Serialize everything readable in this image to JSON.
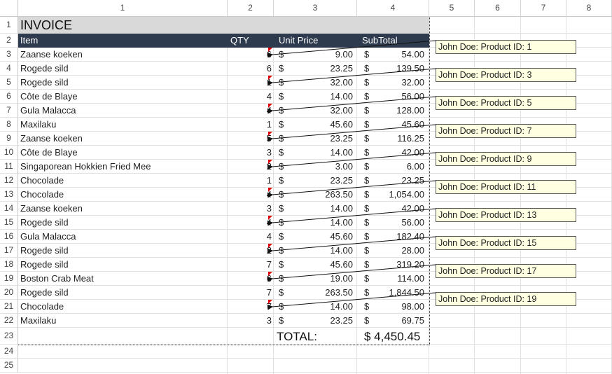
{
  "columns": [
    "1",
    "2",
    "3",
    "4",
    "5",
    "6",
    "7",
    "8"
  ],
  "rows": [
    "1",
    "2",
    "3",
    "4",
    "5",
    "6",
    "7",
    "8",
    "9",
    "10",
    "11",
    "12",
    "13",
    "14",
    "15",
    "16",
    "17",
    "18",
    "19",
    "20",
    "21",
    "22",
    "23",
    "24",
    "25"
  ],
  "invoice": {
    "title": "INVOICE",
    "headers": {
      "item": "Item",
      "qty": "QTY",
      "unit_price": "Unit Price",
      "subtotal": "SubTotal"
    },
    "currency_symbol": "$",
    "lines": [
      {
        "item": "Zaanse koeken",
        "qty": "6",
        "price": "9.00",
        "subtotal": "54.00"
      },
      {
        "item": "Rogede sild",
        "qty": "6",
        "price": "23.25",
        "subtotal": "139.50"
      },
      {
        "item": "Rogede sild",
        "qty": "1",
        "price": "32.00",
        "subtotal": "32.00"
      },
      {
        "item": "Côte de Blaye",
        "qty": "4",
        "price": "14.00",
        "subtotal": "56.00"
      },
      {
        "item": "Gula Malacca",
        "qty": "4",
        "price": "32.00",
        "subtotal": "128.00"
      },
      {
        "item": "Maxilaku",
        "qty": "1",
        "price": "45.60",
        "subtotal": "45.60"
      },
      {
        "item": "Zaanse koeken",
        "qty": "5",
        "price": "23.25",
        "subtotal": "116.25"
      },
      {
        "item": "Côte de Blaye",
        "qty": "3",
        "price": "14.00",
        "subtotal": "42.00"
      },
      {
        "item": "Singaporean Hokkien Fried Mee",
        "qty": "2",
        "price": "3.00",
        "subtotal": "6.00"
      },
      {
        "item": "Chocolade",
        "qty": "1",
        "price": "23.25",
        "subtotal": "23.25"
      },
      {
        "item": "Chocolade",
        "qty": "4",
        "price": "263.50",
        "subtotal": "1,054.00"
      },
      {
        "item": "Zaanse koeken",
        "qty": "3",
        "price": "14.00",
        "subtotal": "42.00"
      },
      {
        "item": "Rogede sild",
        "qty": "4",
        "price": "14.00",
        "subtotal": "56.00"
      },
      {
        "item": "Gula Malacca",
        "qty": "4",
        "price": "45.60",
        "subtotal": "182.40"
      },
      {
        "item": "Rogede sild",
        "qty": "2",
        "price": "14.00",
        "subtotal": "28.00"
      },
      {
        "item": "Rogede sild",
        "qty": "7",
        "price": "45.60",
        "subtotal": "319.20"
      },
      {
        "item": "Boston Crab Meat",
        "qty": "6",
        "price": "19.00",
        "subtotal": "114.00"
      },
      {
        "item": "Rogede sild",
        "qty": "7",
        "price": "263.50",
        "subtotal": "1,844.50"
      },
      {
        "item": "Chocolade",
        "qty": "7",
        "price": "14.00",
        "subtotal": "98.00"
      },
      {
        "item": "Maxilaku",
        "qty": "3",
        "price": "23.25",
        "subtotal": "69.75"
      }
    ],
    "total_label": "TOTAL:",
    "total_value": "$ 4,450.45"
  },
  "comments": [
    "John Doe: Product ID: 1",
    "John Doe: Product ID: 3",
    "John Doe: Product ID: 5",
    "John Doe: Product ID: 7",
    "John Doe: Product ID: 9",
    "John Doe: Product ID: 11",
    "John Doe: Product ID: 13",
    "John Doe: Product ID: 15",
    "John Doe: Product ID: 17",
    "John Doe: Product ID: 19"
  ],
  "colors": {
    "header_band": "#2e3b4e",
    "title_band": "#d9d9d9",
    "comment_bg": "#ffffe1",
    "comment_marker": "#e10000"
  }
}
